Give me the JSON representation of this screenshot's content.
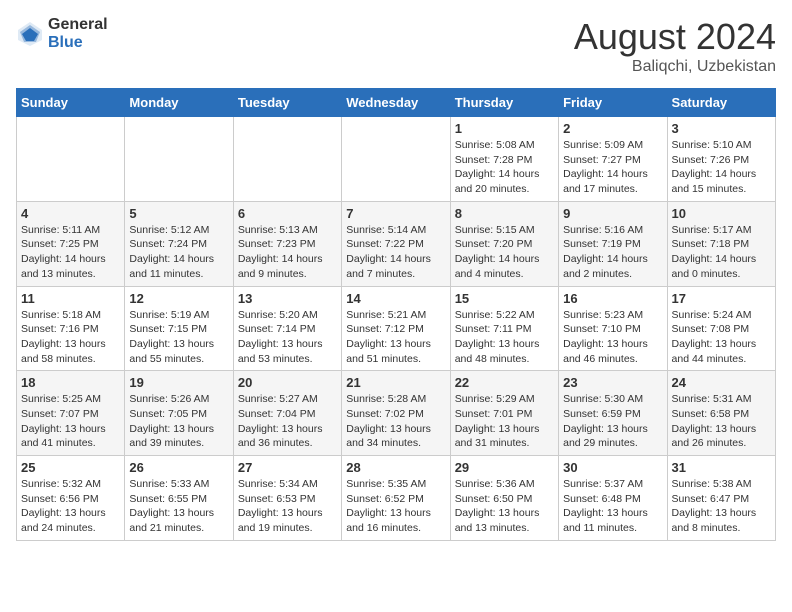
{
  "header": {
    "logo_general": "General",
    "logo_blue": "Blue",
    "month_title": "August 2024",
    "location": "Baliqchi, Uzbekistan"
  },
  "days_of_week": [
    "Sunday",
    "Monday",
    "Tuesday",
    "Wednesday",
    "Thursday",
    "Friday",
    "Saturday"
  ],
  "weeks": [
    [
      {
        "day": "",
        "sunrise": "",
        "sunset": "",
        "daylight": ""
      },
      {
        "day": "",
        "sunrise": "",
        "sunset": "",
        "daylight": ""
      },
      {
        "day": "",
        "sunrise": "",
        "sunset": "",
        "daylight": ""
      },
      {
        "day": "",
        "sunrise": "",
        "sunset": "",
        "daylight": ""
      },
      {
        "day": "1",
        "sunrise": "Sunrise: 5:08 AM",
        "sunset": "Sunset: 7:28 PM",
        "daylight": "Daylight: 14 hours and 20 minutes."
      },
      {
        "day": "2",
        "sunrise": "Sunrise: 5:09 AM",
        "sunset": "Sunset: 7:27 PM",
        "daylight": "Daylight: 14 hours and 17 minutes."
      },
      {
        "day": "3",
        "sunrise": "Sunrise: 5:10 AM",
        "sunset": "Sunset: 7:26 PM",
        "daylight": "Daylight: 14 hours and 15 minutes."
      }
    ],
    [
      {
        "day": "4",
        "sunrise": "Sunrise: 5:11 AM",
        "sunset": "Sunset: 7:25 PM",
        "daylight": "Daylight: 14 hours and 13 minutes."
      },
      {
        "day": "5",
        "sunrise": "Sunrise: 5:12 AM",
        "sunset": "Sunset: 7:24 PM",
        "daylight": "Daylight: 14 hours and 11 minutes."
      },
      {
        "day": "6",
        "sunrise": "Sunrise: 5:13 AM",
        "sunset": "Sunset: 7:23 PM",
        "daylight": "Daylight: 14 hours and 9 minutes."
      },
      {
        "day": "7",
        "sunrise": "Sunrise: 5:14 AM",
        "sunset": "Sunset: 7:22 PM",
        "daylight": "Daylight: 14 hours and 7 minutes."
      },
      {
        "day": "8",
        "sunrise": "Sunrise: 5:15 AM",
        "sunset": "Sunset: 7:20 PM",
        "daylight": "Daylight: 14 hours and 4 minutes."
      },
      {
        "day": "9",
        "sunrise": "Sunrise: 5:16 AM",
        "sunset": "Sunset: 7:19 PM",
        "daylight": "Daylight: 14 hours and 2 minutes."
      },
      {
        "day": "10",
        "sunrise": "Sunrise: 5:17 AM",
        "sunset": "Sunset: 7:18 PM",
        "daylight": "Daylight: 14 hours and 0 minutes."
      }
    ],
    [
      {
        "day": "11",
        "sunrise": "Sunrise: 5:18 AM",
        "sunset": "Sunset: 7:16 PM",
        "daylight": "Daylight: 13 hours and 58 minutes."
      },
      {
        "day": "12",
        "sunrise": "Sunrise: 5:19 AM",
        "sunset": "Sunset: 7:15 PM",
        "daylight": "Daylight: 13 hours and 55 minutes."
      },
      {
        "day": "13",
        "sunrise": "Sunrise: 5:20 AM",
        "sunset": "Sunset: 7:14 PM",
        "daylight": "Daylight: 13 hours and 53 minutes."
      },
      {
        "day": "14",
        "sunrise": "Sunrise: 5:21 AM",
        "sunset": "Sunset: 7:12 PM",
        "daylight": "Daylight: 13 hours and 51 minutes."
      },
      {
        "day": "15",
        "sunrise": "Sunrise: 5:22 AM",
        "sunset": "Sunset: 7:11 PM",
        "daylight": "Daylight: 13 hours and 48 minutes."
      },
      {
        "day": "16",
        "sunrise": "Sunrise: 5:23 AM",
        "sunset": "Sunset: 7:10 PM",
        "daylight": "Daylight: 13 hours and 46 minutes."
      },
      {
        "day": "17",
        "sunrise": "Sunrise: 5:24 AM",
        "sunset": "Sunset: 7:08 PM",
        "daylight": "Daylight: 13 hours and 44 minutes."
      }
    ],
    [
      {
        "day": "18",
        "sunrise": "Sunrise: 5:25 AM",
        "sunset": "Sunset: 7:07 PM",
        "daylight": "Daylight: 13 hours and 41 minutes."
      },
      {
        "day": "19",
        "sunrise": "Sunrise: 5:26 AM",
        "sunset": "Sunset: 7:05 PM",
        "daylight": "Daylight: 13 hours and 39 minutes."
      },
      {
        "day": "20",
        "sunrise": "Sunrise: 5:27 AM",
        "sunset": "Sunset: 7:04 PM",
        "daylight": "Daylight: 13 hours and 36 minutes."
      },
      {
        "day": "21",
        "sunrise": "Sunrise: 5:28 AM",
        "sunset": "Sunset: 7:02 PM",
        "daylight": "Daylight: 13 hours and 34 minutes."
      },
      {
        "day": "22",
        "sunrise": "Sunrise: 5:29 AM",
        "sunset": "Sunset: 7:01 PM",
        "daylight": "Daylight: 13 hours and 31 minutes."
      },
      {
        "day": "23",
        "sunrise": "Sunrise: 5:30 AM",
        "sunset": "Sunset: 6:59 PM",
        "daylight": "Daylight: 13 hours and 29 minutes."
      },
      {
        "day": "24",
        "sunrise": "Sunrise: 5:31 AM",
        "sunset": "Sunset: 6:58 PM",
        "daylight": "Daylight: 13 hours and 26 minutes."
      }
    ],
    [
      {
        "day": "25",
        "sunrise": "Sunrise: 5:32 AM",
        "sunset": "Sunset: 6:56 PM",
        "daylight": "Daylight: 13 hours and 24 minutes."
      },
      {
        "day": "26",
        "sunrise": "Sunrise: 5:33 AM",
        "sunset": "Sunset: 6:55 PM",
        "daylight": "Daylight: 13 hours and 21 minutes."
      },
      {
        "day": "27",
        "sunrise": "Sunrise: 5:34 AM",
        "sunset": "Sunset: 6:53 PM",
        "daylight": "Daylight: 13 hours and 19 minutes."
      },
      {
        "day": "28",
        "sunrise": "Sunrise: 5:35 AM",
        "sunset": "Sunset: 6:52 PM",
        "daylight": "Daylight: 13 hours and 16 minutes."
      },
      {
        "day": "29",
        "sunrise": "Sunrise: 5:36 AM",
        "sunset": "Sunset: 6:50 PM",
        "daylight": "Daylight: 13 hours and 13 minutes."
      },
      {
        "day": "30",
        "sunrise": "Sunrise: 5:37 AM",
        "sunset": "Sunset: 6:48 PM",
        "daylight": "Daylight: 13 hours and 11 minutes."
      },
      {
        "day": "31",
        "sunrise": "Sunrise: 5:38 AM",
        "sunset": "Sunset: 6:47 PM",
        "daylight": "Daylight: 13 hours and 8 minutes."
      }
    ]
  ]
}
